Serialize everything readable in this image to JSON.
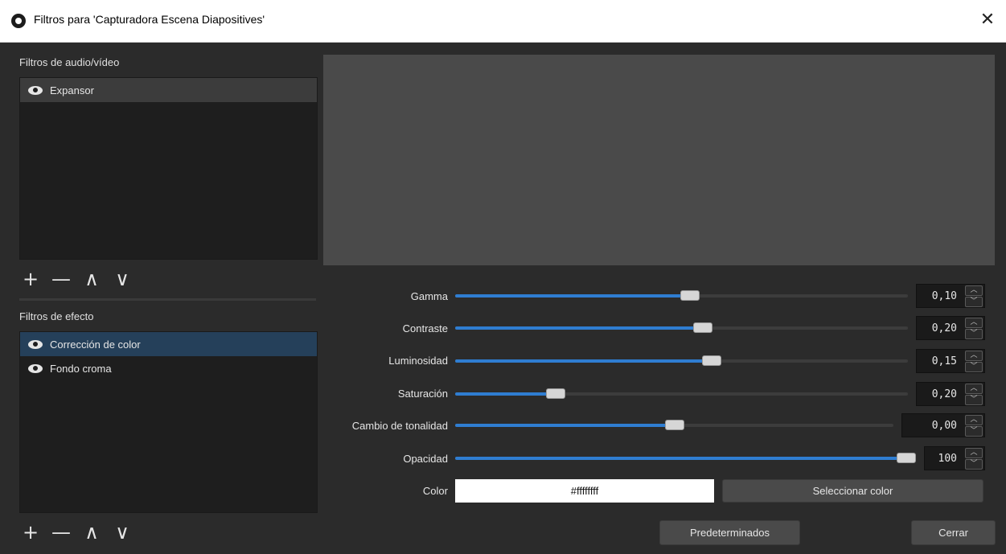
{
  "window": {
    "title": "Filtros para 'Capturadora Escena Diapositives'",
    "close_glyph": "✕",
    "app_icon": "obs-logo-icon"
  },
  "av_filters": {
    "label": "Filtros de audio/vídeo",
    "items": [
      {
        "label": "Expansor",
        "visible": true
      }
    ]
  },
  "effect_filters": {
    "label": "Filtros de efecto",
    "items": [
      {
        "label": "Corrección de color",
        "visible": true
      },
      {
        "label": "Fondo croma",
        "visible": true
      }
    ]
  },
  "toolbar": {
    "add_glyph": "+",
    "remove_glyph": "—",
    "up_glyph": "∧",
    "down_glyph": "∨"
  },
  "properties": {
    "gamma": {
      "label": "Gamma",
      "value": "0,10",
      "level": 0.52
    },
    "contrast": {
      "label": "Contraste",
      "value": "0,20",
      "level": 0.55
    },
    "brightness": {
      "label": "Luminosidad",
      "value": "0,15",
      "level": 0.57
    },
    "saturation": {
      "label": "Saturación",
      "value": "0,20",
      "level": 0.21
    },
    "hue_shift": {
      "label": "Cambio de tonalidad",
      "value": "0,00",
      "level": 0.5
    },
    "opacity": {
      "label": "Opacidad",
      "value": "100",
      "level": 1.0
    },
    "color": {
      "label": "Color",
      "value": "#ffffffff",
      "button": "Seleccionar color"
    }
  },
  "footer": {
    "defaults_button": "Predeterminados",
    "close_button": "Cerrar"
  },
  "colors": {
    "accent": "#2f7dd1",
    "selection": "#25405a"
  }
}
